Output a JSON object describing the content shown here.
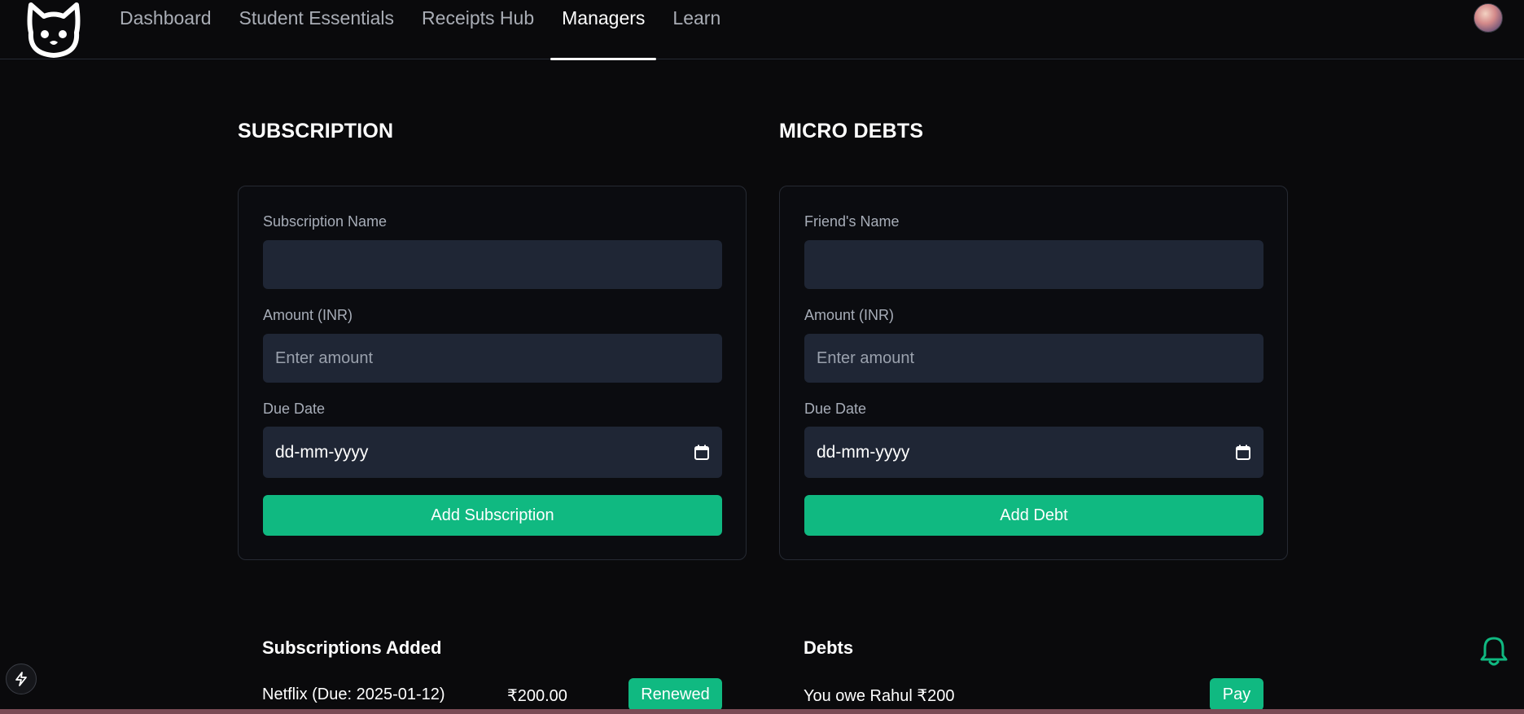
{
  "nav": {
    "links": [
      {
        "label": "Dashboard"
      },
      {
        "label": "Student Essentials"
      },
      {
        "label": "Receipts Hub"
      },
      {
        "label": "Managers",
        "active": true
      },
      {
        "label": "Learn"
      }
    ]
  },
  "subscription": {
    "title": "SUBSCRIPTION",
    "name_label": "Subscription Name",
    "name_value": "",
    "amount_label": "Amount (INR)",
    "amount_placeholder": "Enter amount",
    "date_label": "Due Date",
    "date_placeholder": "dd-mm-yyyy",
    "submit_label": "Add Subscription"
  },
  "debts": {
    "title": "MICRO DEBTS",
    "name_label": "Friend's Name",
    "name_value": "",
    "amount_label": "Amount (INR)",
    "amount_placeholder": "Enter amount",
    "date_label": "Due Date",
    "date_placeholder": "dd-mm-yyyy",
    "submit_label": "Add Debt"
  },
  "subscriptions_list": {
    "title": "Subscriptions Added",
    "items": [
      {
        "label": "Netflix (Due: 2025-01-12)",
        "amount": "₹200.00",
        "action": "Renewed"
      }
    ]
  },
  "debts_list": {
    "title": "Debts",
    "items": [
      {
        "label": "You owe Rahul ₹200",
        "action": "Pay"
      }
    ]
  },
  "icons": {
    "logo": "cat-logo-icon",
    "calendar": "calendar-icon",
    "bolt": "bolt-icon",
    "bell": "bell-icon"
  },
  "colors": {
    "background": "#0a0a0c",
    "input": "#1f2635",
    "accent": "#10b981",
    "muted_text": "#a7adb8"
  }
}
